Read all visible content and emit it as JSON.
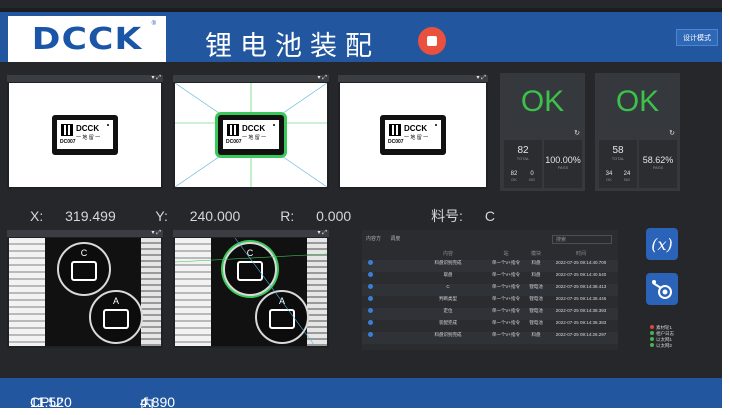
{
  "header": {
    "logo": "DCCK",
    "title": "锂电池装配",
    "design_mode_label": "设计模式"
  },
  "cameras": {
    "card_brand": "DCCK",
    "card_sub": "一 地 留 一",
    "card_code": "DC007"
  },
  "results": [
    {
      "status": "OK",
      "total": "82",
      "total_label": "TOTAL",
      "pass_rate": "100.00%",
      "pass_label": "PASS",
      "ok_count": "82",
      "ok_label": "OK",
      "ng_count": "0",
      "ng_label": "NG"
    },
    {
      "status": "OK",
      "total": "58",
      "total_label": "TOTAL",
      "pass_rate": "58.62%",
      "pass_label": "PASS",
      "ok_count": "34",
      "ok_label": "OK",
      "ng_count": "24",
      "ng_label": "NG"
    }
  ],
  "coords": {
    "x_label": "X:",
    "x_value": "319.499",
    "y_label": "Y:",
    "y_value": "240.000",
    "r_label": "R:",
    "r_value": "0.000",
    "material_label": "料号:",
    "material_value": "C"
  },
  "bottom_cam": {
    "circle_top": "C",
    "circle_bottom": "A"
  },
  "log": {
    "tabs": [
      "内容方",
      "调度"
    ],
    "search_placeholder": "搜索",
    "headers": [
      "",
      "内容",
      "站",
      "模块",
      "时间"
    ],
    "rows": [
      [
        "料盘识别完成",
        "单一个V+指令",
        "料盘",
        "2022-07-25 09:14:40.700"
      ],
      [
        "取盘",
        "单一个V+指令",
        "料盘",
        "2022-07-25 09:14:40.540"
      ],
      [
        "C",
        "单一个V+指令",
        "锂电池",
        "2022-07-25 09:14:38.413"
      ],
      [
        "判断类型",
        "单一个V+指令",
        "锂电池",
        "2022-07-25 09:14:38.446"
      ],
      [
        "定位",
        "单一个V+指令",
        "锂电池",
        "2022-07-25 09:14:38.393"
      ],
      [
        "装配完成",
        "单一个V+指令",
        "锂电池",
        "2022-07-25 09:14:38.383"
      ],
      [
        "料盘识别完成",
        "单一个V+指令",
        "料盘",
        "2022-07-25 09:14:26.297"
      ]
    ]
  },
  "tools": {
    "variable_icon": "(x)",
    "camera_icon": "camera-icon"
  },
  "legend": [
    "素材轮1",
    "相户日志",
    "以太网1",
    "以太网2"
  ],
  "legend_colors": [
    "#e0443a",
    "#4caf50",
    "#4caf50",
    "#4caf50"
  ],
  "status": {
    "cpu_label": "CPU:",
    "cpu_value": "11.520",
    "mem_label": "内存:",
    "mem_value": "4.890"
  }
}
